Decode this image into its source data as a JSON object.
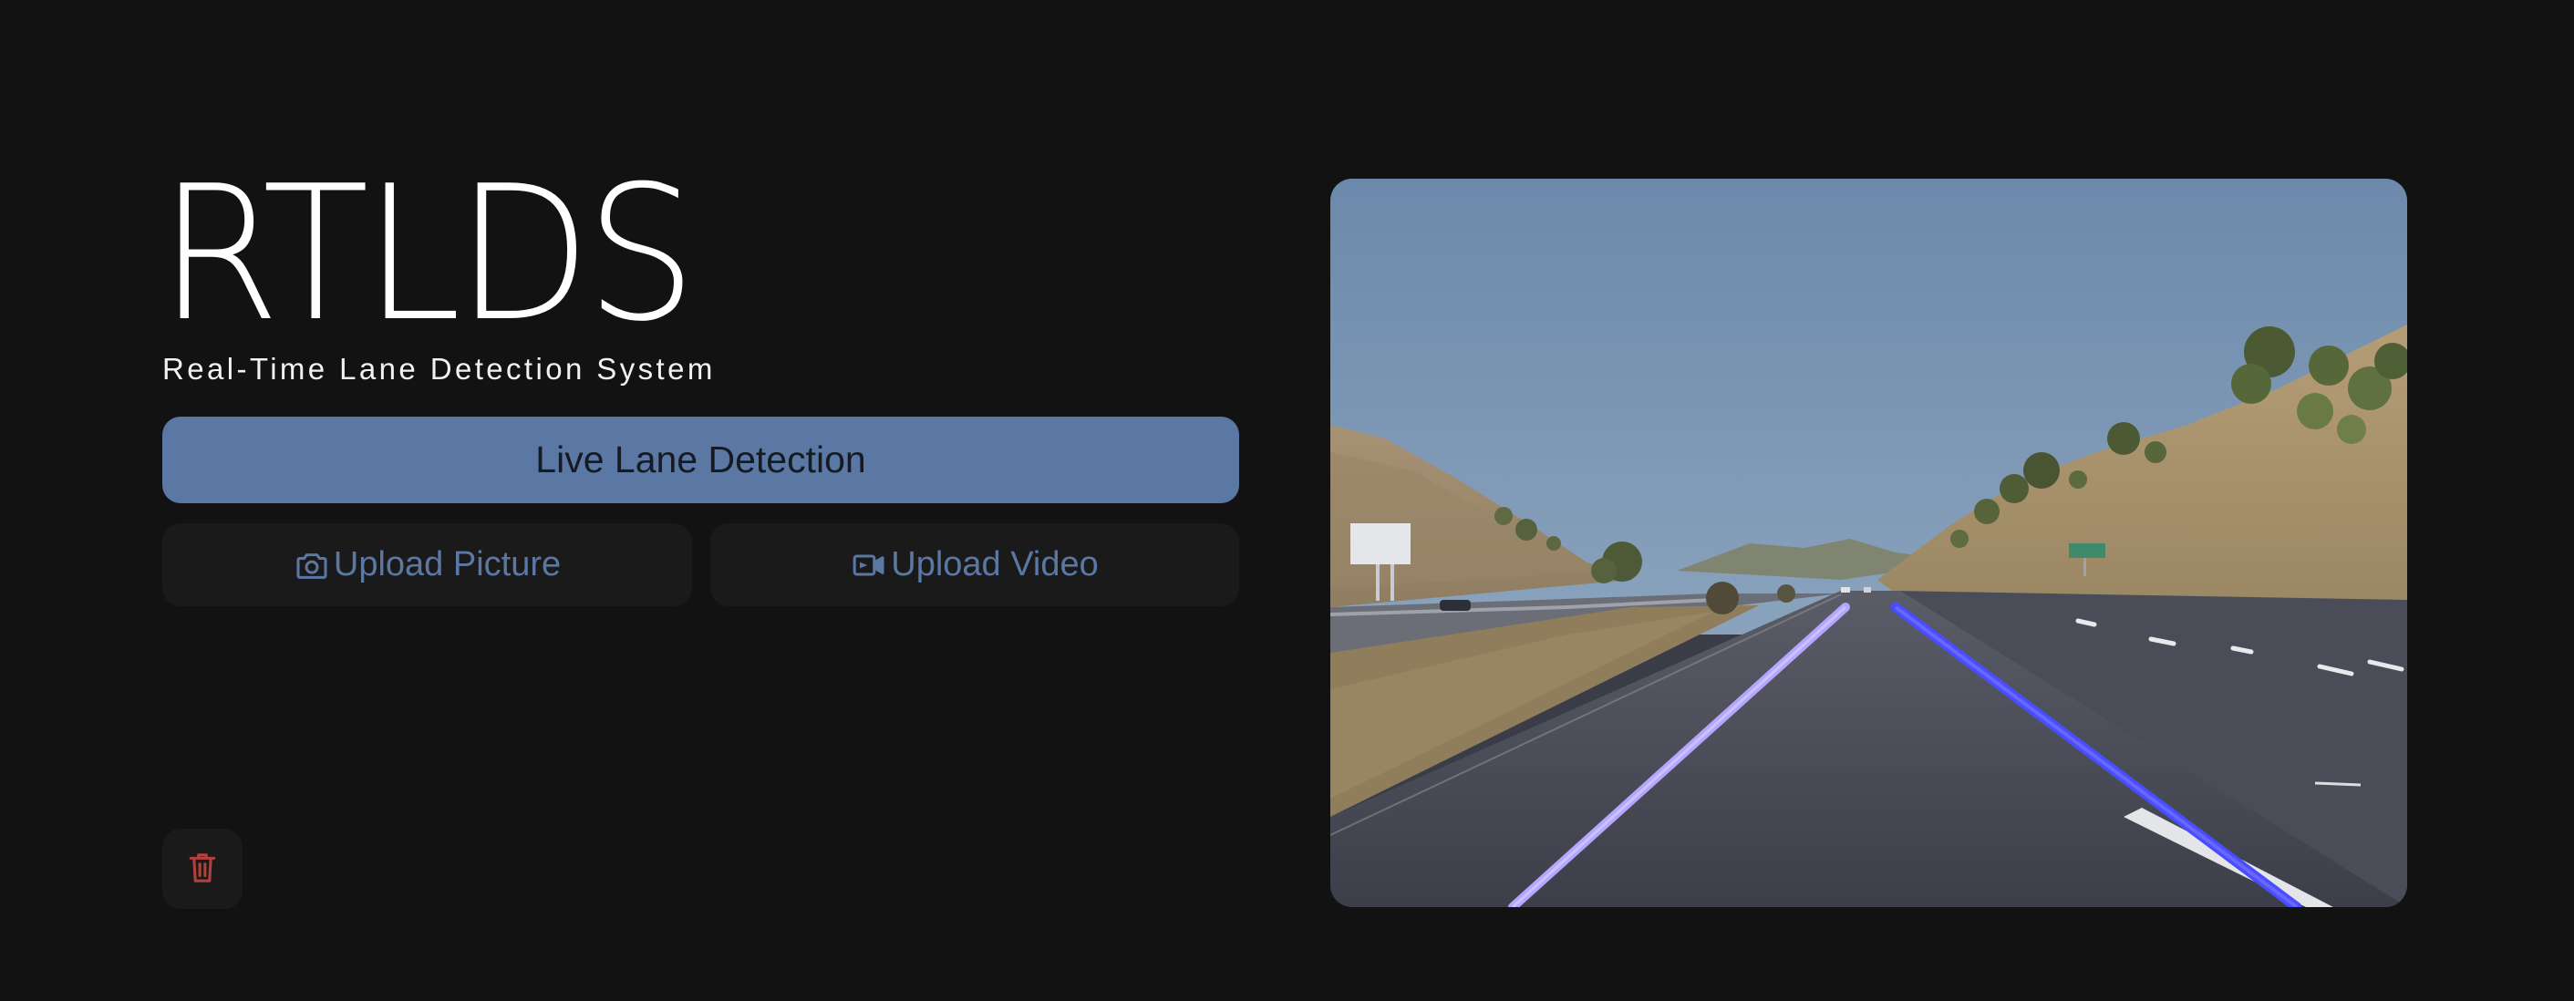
{
  "app": {
    "title": "RTLDS",
    "subtitle": "Real-Time Lane Detection System"
  },
  "actions": {
    "live_label": "Live Lane Detection",
    "upload_picture_label": "Upload Picture",
    "upload_video_label": "Upload Video",
    "delete_icon": "trash-icon",
    "picture_icon": "camera-icon",
    "video_icon": "video-camera-icon"
  },
  "preview": {
    "content": "road scene with detected lane lines",
    "left_lane_color": "#b4a6ff",
    "right_lane_color": "#4a4cff"
  },
  "colors": {
    "background": "#121212",
    "accent": "#5b78a4",
    "surface": "#1a1a1a",
    "danger": "#b2413c",
    "title": "#ffffff"
  }
}
